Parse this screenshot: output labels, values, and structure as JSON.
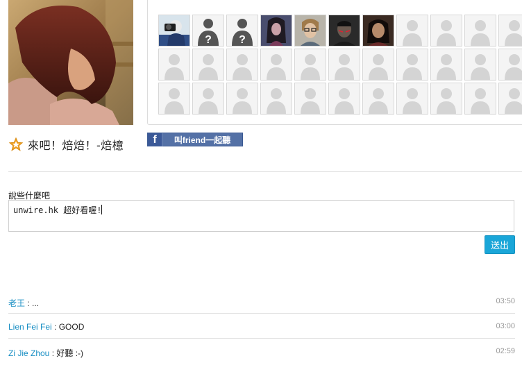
{
  "page": {
    "song_title": "來吧！焙焙！-焙檍",
    "share_button": {
      "logo": "f",
      "label": "叫friend一起聽"
    },
    "colors": {
      "accent": "#1aa6d8",
      "facebook": "#3b5998",
      "star": "#f0a020",
      "link": "#1a8fc4"
    }
  },
  "listeners": [
    {
      "kind": "photo",
      "icon": "camera-person-photo"
    },
    {
      "kind": "unknown",
      "mark": "?"
    },
    {
      "kind": "unknown",
      "mark": "?"
    },
    {
      "kind": "photo",
      "icon": "woman-portrait-photo"
    },
    {
      "kind": "photo",
      "icon": "man-glasses-photo"
    },
    {
      "kind": "photo",
      "icon": "dark-portrait-photo"
    },
    {
      "kind": "photo",
      "icon": "woman-dark-photo"
    },
    {
      "kind": "empty"
    },
    {
      "kind": "empty"
    },
    {
      "kind": "empty"
    },
    {
      "kind": "empty"
    },
    {
      "kind": "empty"
    },
    {
      "kind": "empty"
    },
    {
      "kind": "empty"
    },
    {
      "kind": "empty"
    },
    {
      "kind": "empty"
    },
    {
      "kind": "empty"
    },
    {
      "kind": "empty"
    },
    {
      "kind": "empty"
    },
    {
      "kind": "empty"
    },
    {
      "kind": "empty"
    },
    {
      "kind": "empty"
    },
    {
      "kind": "empty"
    },
    {
      "kind": "empty"
    },
    {
      "kind": "empty"
    },
    {
      "kind": "empty"
    },
    {
      "kind": "empty"
    },
    {
      "kind": "empty"
    },
    {
      "kind": "empty"
    },
    {
      "kind": "empty"
    },
    {
      "kind": "empty"
    },
    {
      "kind": "empty"
    },
    {
      "kind": "empty"
    }
  ],
  "form": {
    "label": "說些什麼吧",
    "value": "unwire.hk 超好看喔!",
    "submit_label": "送出"
  },
  "comments": [
    {
      "author": "老王",
      "separator": " : ",
      "message": "...",
      "time": "03:50"
    },
    {
      "author": "Lien Fei Fei",
      "separator": " : ",
      "message": "GOOD",
      "time": "03:00"
    },
    {
      "author": "Zi Jie Zhou",
      "separator": " : ",
      "message": "好聽 :-)",
      "time": "02:59"
    }
  ]
}
